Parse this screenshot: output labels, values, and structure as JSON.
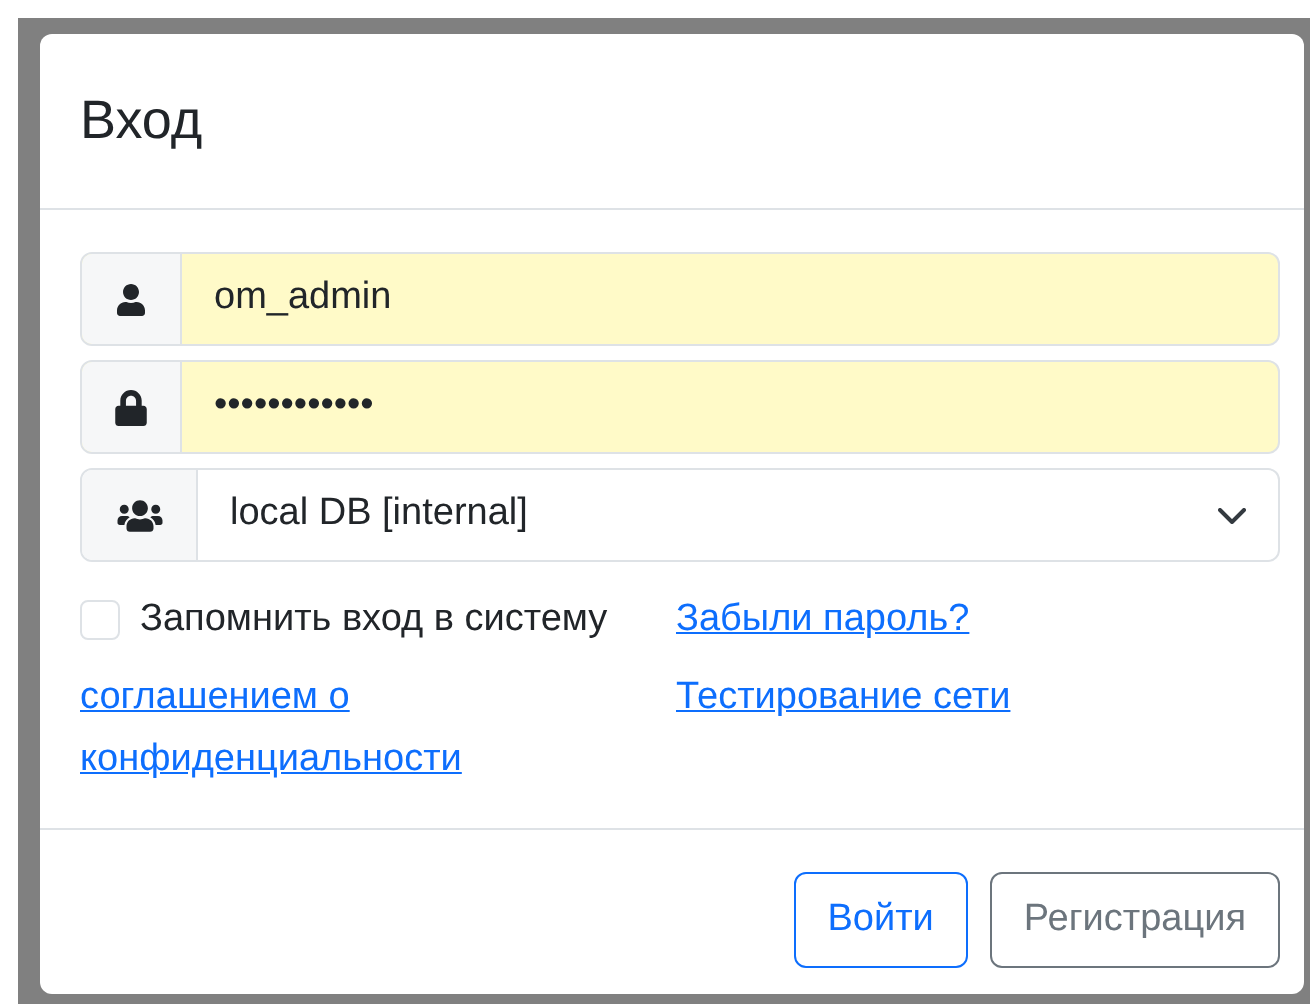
{
  "dialog": {
    "title": "Вход"
  },
  "fields": [
    {
      "kind": "user",
      "value": "om_admin",
      "autofilled": true
    },
    {
      "kind": "password",
      "value": "••••••••••••",
      "autofilled": true
    },
    {
      "kind": "select",
      "value": "local DB [internal]",
      "autofilled": false
    }
  ],
  "remember": {
    "label": "Запомнить вход в систему",
    "checked": false
  },
  "links": [
    {
      "label": "Забыли пароль?"
    },
    {
      "label": "соглашением о конфиденциальности"
    },
    {
      "label": "Тестирование сети"
    }
  ],
  "buttons": [
    {
      "kind": "primary",
      "label": "Войти"
    },
    {
      "kind": "secondary",
      "label": "Регистрация"
    }
  ]
}
